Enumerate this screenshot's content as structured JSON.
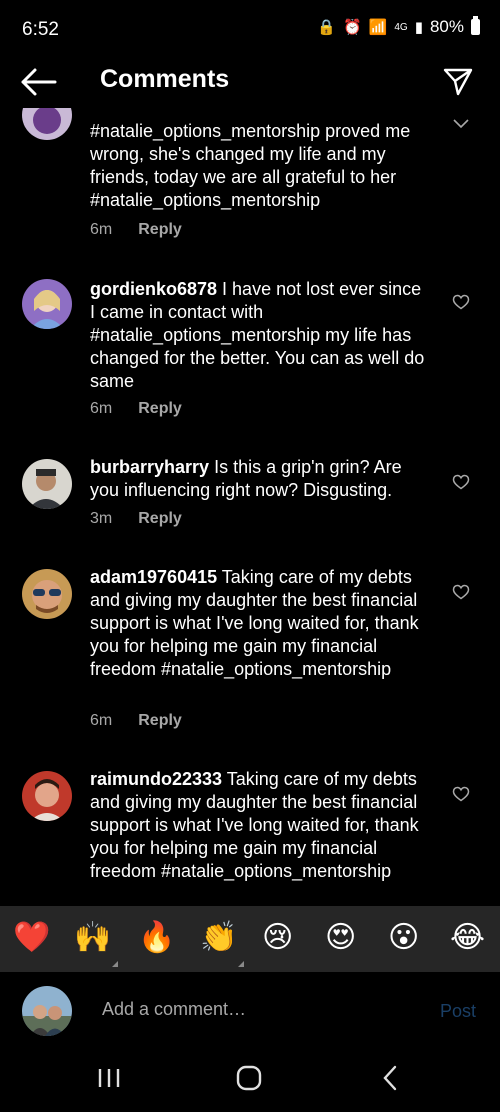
{
  "status": {
    "time": "6:52",
    "network": "4G",
    "battery": "80%"
  },
  "header": {
    "title": "Comments"
  },
  "comments": [
    {
      "username": "",
      "text": "#natalie_options_mentorship proved me wrong, she's changed my life and my friends, today we are all grateful to her #natalie_options_mentorship",
      "time": "6m",
      "reply": "Reply"
    },
    {
      "username": "gordienko6878",
      "text": " I have not lost ever since I came in contact with #natalie_options_mentorship my life has changed for the better. You can as well do same",
      "time": "6m",
      "reply": "Reply"
    },
    {
      "username": "burbarryharry",
      "text": " Is this a grip'n grin? Are you influencing right now? Disgusting.",
      "time": "3m",
      "reply": "Reply"
    },
    {
      "username": "adam19760415",
      "text": " Taking care of my debts and giving my daughter the best financial support is what I've long waited for, thank you for helping me gain my financial freedom #natalie_options_mentorship",
      "time": "6m",
      "reply": "Reply"
    },
    {
      "username": "raimundo22333",
      "text": " Taking care of my debts and giving my daughter the best financial support is what I've long waited for, thank you for helping me gain my financial freedom #natalie_options_mentorship",
      "time": "",
      "reply": ""
    }
  ],
  "reactions": [
    "❤️",
    "🙌",
    "🔥",
    "👏",
    "😢",
    "😍",
    "😮",
    "😂"
  ],
  "composer": {
    "placeholder": "Add a comment…",
    "post_label": "Post"
  },
  "colors": {
    "background": "#000000",
    "reaction_bar": "#262626",
    "post_disabled": "#1a3f66",
    "meta": "#a8a8a8"
  }
}
